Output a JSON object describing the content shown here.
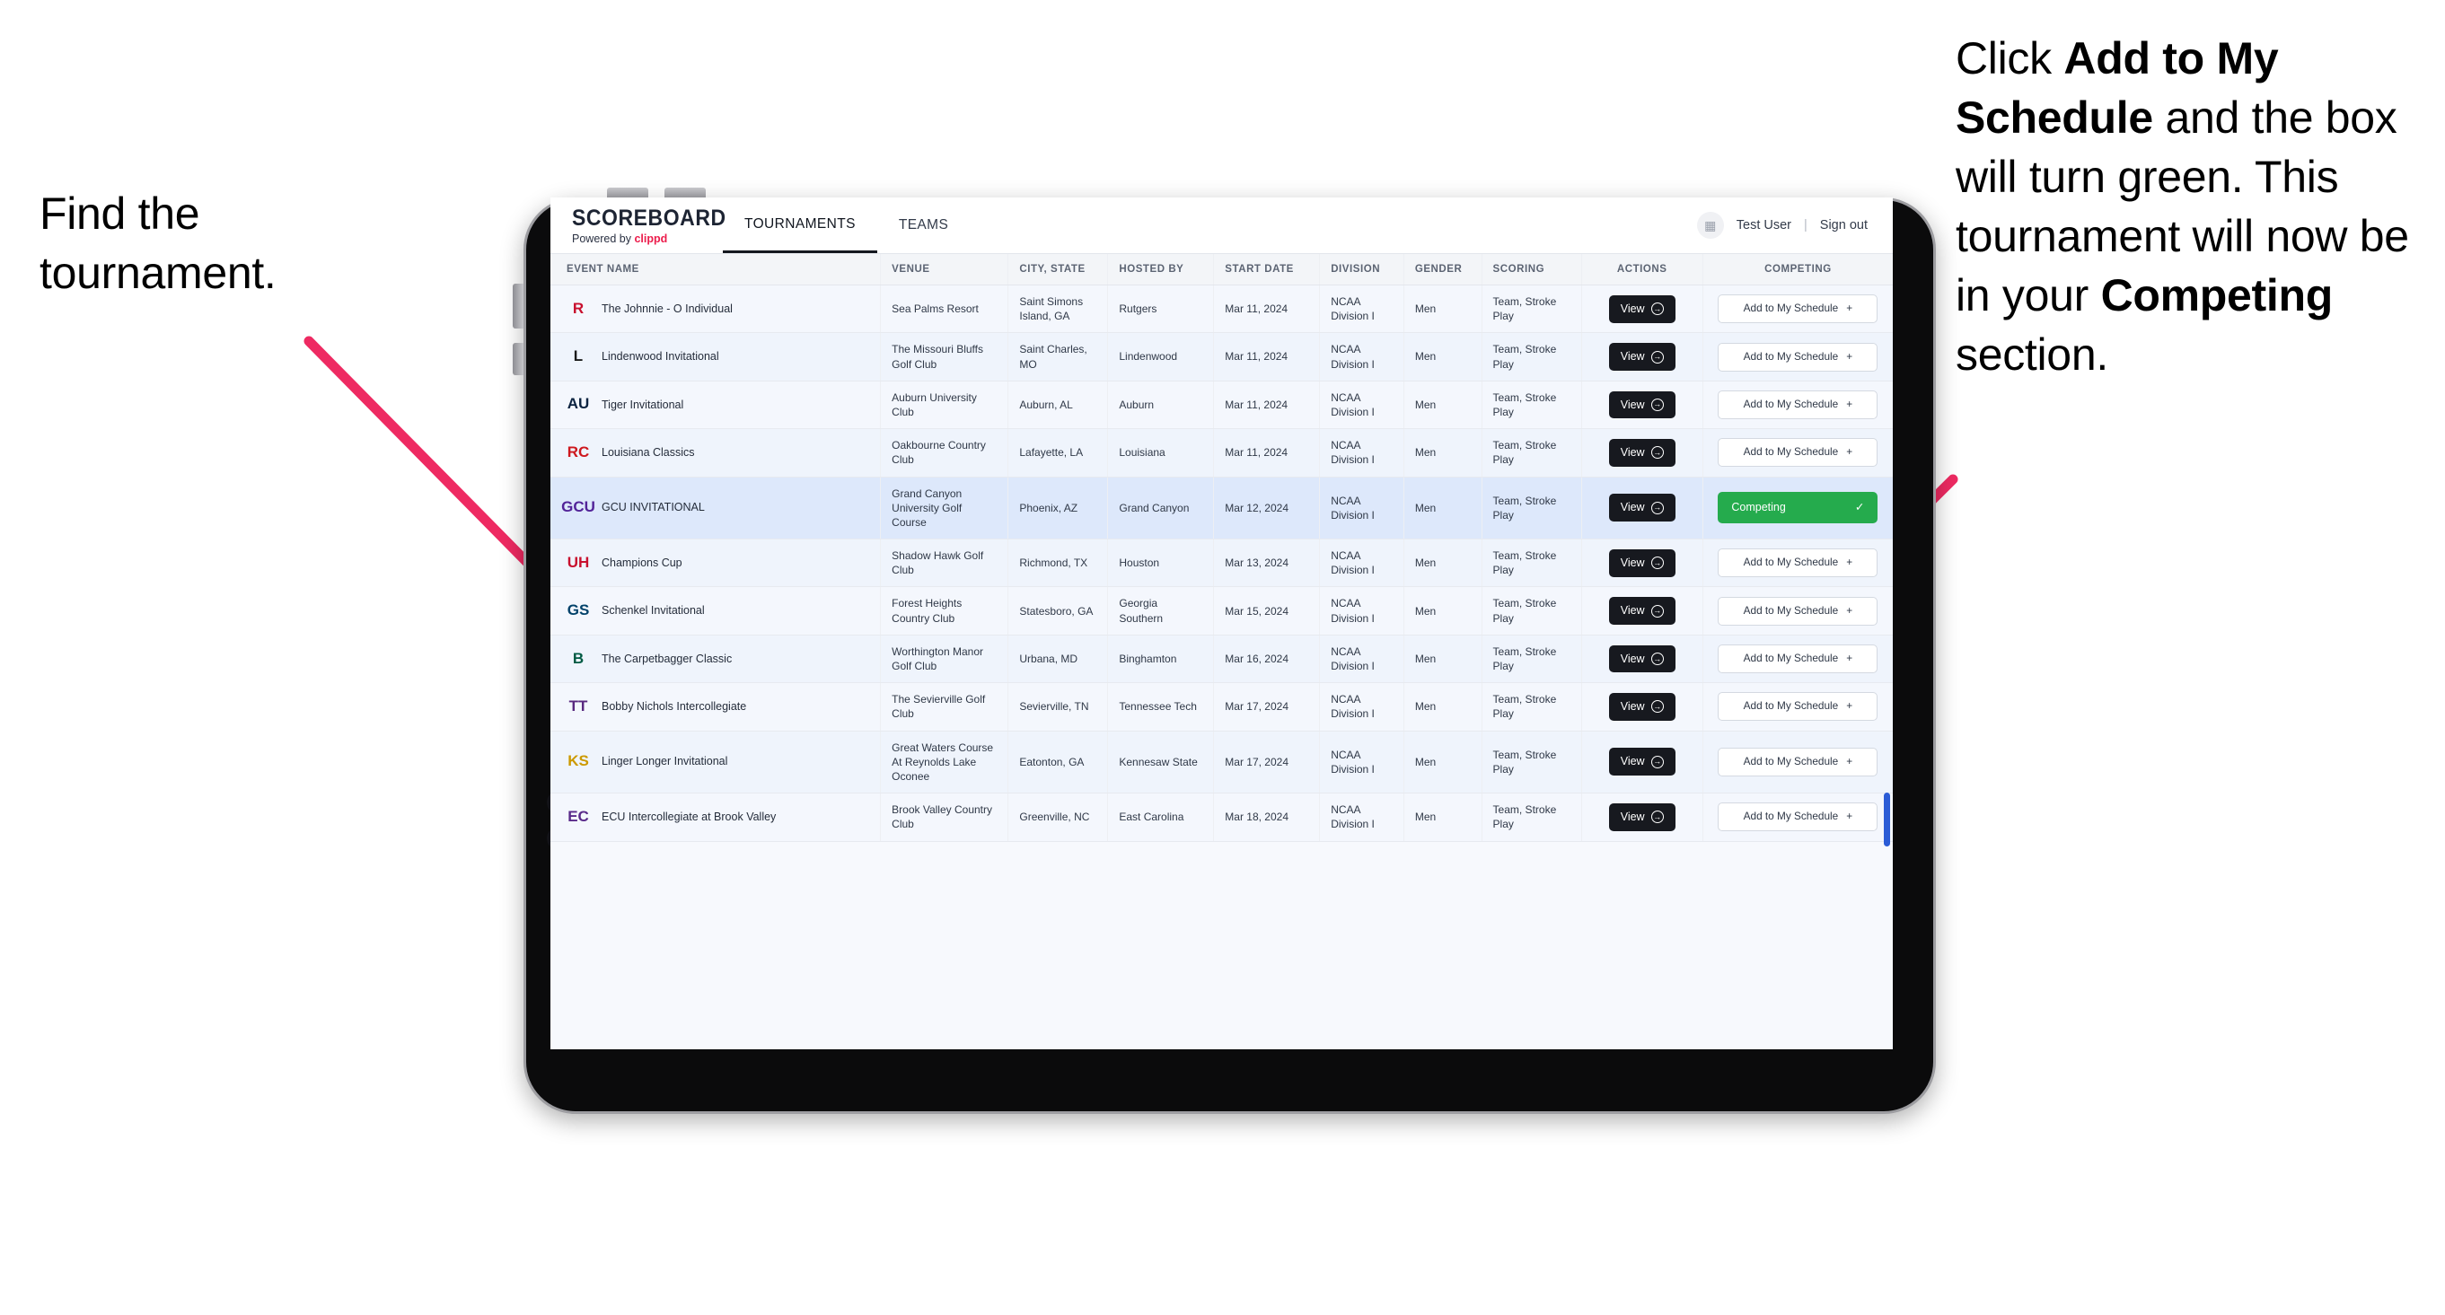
{
  "annotations": {
    "left": {
      "line1": "Find the",
      "line2": "tournament."
    },
    "right": {
      "part1": "Click ",
      "bold1": "Add to My Schedule",
      "part2": " and the box will turn green. This tournament will now be in your ",
      "bold2": "Competing",
      "part3": " section."
    },
    "arrow_color": "#ee2a62"
  },
  "app": {
    "brand": {
      "title": "SCOREBOARD",
      "powered_prefix": "Powered by ",
      "powered_name": "clippd",
      "clippd_color": "#ec1c4b"
    },
    "nav": [
      {
        "label": "TOURNAMENTS",
        "active": true
      },
      {
        "label": "TEAMS",
        "active": false
      }
    ],
    "account": {
      "avatar_icon": "grid-icon",
      "user": "Test User",
      "separator": "|",
      "sign_out": "Sign out"
    }
  },
  "table": {
    "columns": [
      "EVENT NAME",
      "VENUE",
      "CITY, STATE",
      "HOSTED BY",
      "START DATE",
      "DIVISION",
      "GENDER",
      "SCORING",
      "ACTIONS",
      "COMPETING"
    ],
    "view_label": "View",
    "add_label": "Add to My Schedule",
    "add_icon": "plus-icon",
    "competing_label": "Competing",
    "competing_icon": "check-icon",
    "competing_color": "#25ab4d",
    "rows": [
      {
        "logo_text": "R",
        "logo_color": "#c8102e",
        "logo_bg": "transparent",
        "event": "The Johnnie - O Individual",
        "venue": "Sea Palms Resort",
        "city": "Saint Simons Island, GA",
        "host": "Rutgers",
        "date": "Mar 11, 2024",
        "division": "NCAA Division I",
        "gender": "Men",
        "scoring": "Team, Stroke Play",
        "competing": false
      },
      {
        "logo_text": "L",
        "logo_color": "#1a1a1a",
        "logo_bg": "transparent",
        "event": "Lindenwood Invitational",
        "venue": "The Missouri Bluffs Golf Club",
        "city": "Saint Charles, MO",
        "host": "Lindenwood",
        "date": "Mar 11, 2024",
        "division": "NCAA Division I",
        "gender": "Men",
        "scoring": "Team, Stroke Play",
        "competing": false
      },
      {
        "logo_text": "AU",
        "logo_color": "#0c2340",
        "logo_bg": "transparent",
        "event": "Tiger Invitational",
        "venue": "Auburn University Club",
        "city": "Auburn, AL",
        "host": "Auburn",
        "date": "Mar 11, 2024",
        "division": "NCAA Division I",
        "gender": "Men",
        "scoring": "Team, Stroke Play",
        "competing": false
      },
      {
        "logo_text": "RC",
        "logo_color": "#ce181e",
        "logo_bg": "transparent",
        "event": "Louisiana Classics",
        "venue": "Oakbourne Country Club",
        "city": "Lafayette, LA",
        "host": "Louisiana",
        "date": "Mar 11, 2024",
        "division": "NCAA Division I",
        "gender": "Men",
        "scoring": "Team, Stroke Play",
        "competing": false
      },
      {
        "logo_text": "GCU",
        "logo_color": "#522398",
        "logo_bg": "transparent",
        "event": "GCU INVITATIONAL",
        "venue": "Grand Canyon University Golf Course",
        "city": "Phoenix, AZ",
        "host": "Grand Canyon",
        "date": "Mar 12, 2024",
        "division": "NCAA Division I",
        "gender": "Men",
        "scoring": "Team, Stroke Play",
        "competing": true
      },
      {
        "logo_text": "UH",
        "logo_color": "#c8102e",
        "logo_bg": "transparent",
        "event": "Champions Cup",
        "venue": "Shadow Hawk Golf Club",
        "city": "Richmond, TX",
        "host": "Houston",
        "date": "Mar 13, 2024",
        "division": "NCAA Division I",
        "gender": "Men",
        "scoring": "Team, Stroke Play",
        "competing": false
      },
      {
        "logo_text": "GS",
        "logo_color": "#01426a",
        "logo_bg": "transparent",
        "event": "Schenkel Invitational",
        "venue": "Forest Heights Country Club",
        "city": "Statesboro, GA",
        "host": "Georgia Southern",
        "date": "Mar 15, 2024",
        "division": "NCAA Division I",
        "gender": "Men",
        "scoring": "Team, Stroke Play",
        "competing": false
      },
      {
        "logo_text": "B",
        "logo_color": "#005a43",
        "logo_bg": "transparent",
        "event": "The Carpetbagger Classic",
        "venue": "Worthington Manor Golf Club",
        "city": "Urbana, MD",
        "host": "Binghamton",
        "date": "Mar 16, 2024",
        "division": "NCAA Division I",
        "gender": "Men",
        "scoring": "Team, Stroke Play",
        "competing": false
      },
      {
        "logo_text": "TT",
        "logo_color": "#58287f",
        "logo_bg": "transparent",
        "event": "Bobby Nichols Intercollegiate",
        "venue": "The Sevierville Golf Club",
        "city": "Sevierville, TN",
        "host": "Tennessee Tech",
        "date": "Mar 17, 2024",
        "division": "NCAA Division I",
        "gender": "Men",
        "scoring": "Team, Stroke Play",
        "competing": false
      },
      {
        "logo_text": "KS",
        "logo_color": "#cc9900",
        "logo_bg": "transparent",
        "event": "Linger Longer Invitational",
        "venue": "Great Waters Course At Reynolds Lake Oconee",
        "city": "Eatonton, GA",
        "host": "Kennesaw State",
        "date": "Mar 17, 2024",
        "division": "NCAA Division I",
        "gender": "Men",
        "scoring": "Team, Stroke Play",
        "competing": false
      },
      {
        "logo_text": "EC",
        "logo_color": "#592a8a",
        "logo_bg": "transparent",
        "event": "ECU Intercollegiate at Brook Valley",
        "venue": "Brook Valley Country Club",
        "city": "Greenville, NC",
        "host": "East Carolina",
        "date": "Mar 18, 2024",
        "division": "NCAA Division I",
        "gender": "Men",
        "scoring": "Team, Stroke Play",
        "competing": false
      }
    ]
  }
}
